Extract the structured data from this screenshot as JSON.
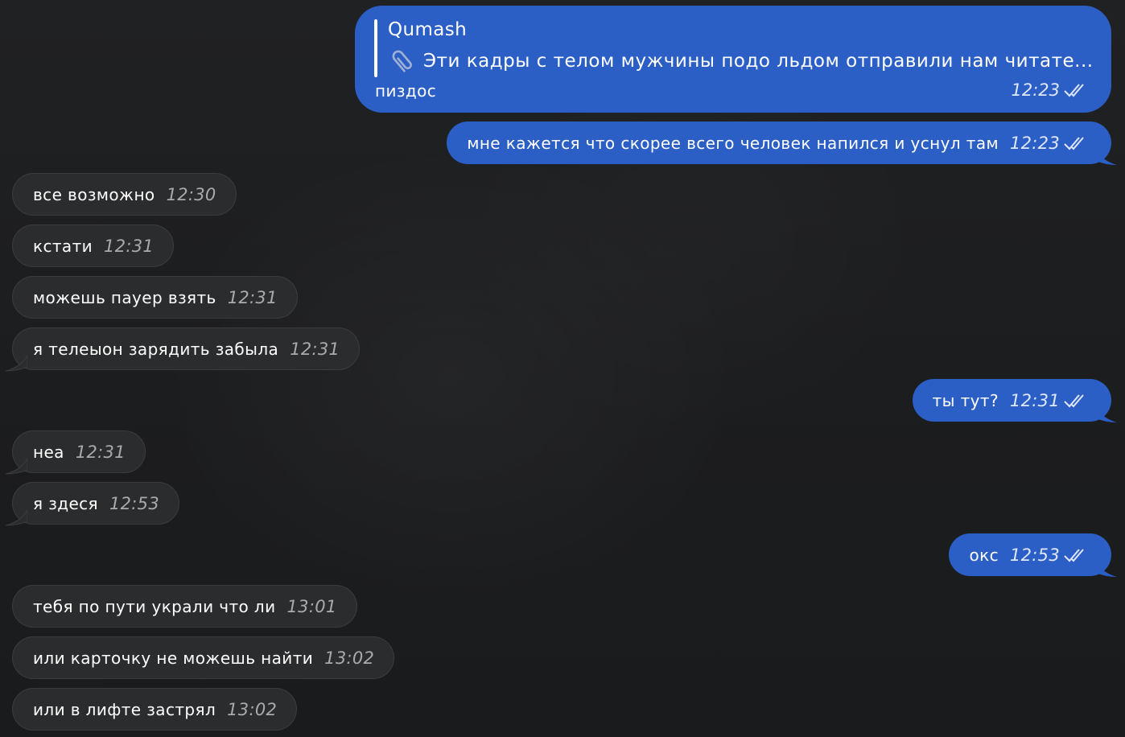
{
  "reply_message": {
    "quoted_author": "Qumash",
    "quoted_icon": "paperclip-icon",
    "quoted_text": "Эти кадры с телом мужчины подо льдом отправили нам читате...",
    "text": "пиздос",
    "time": "12:23",
    "status_icon": "double-check-icon"
  },
  "messages": [
    {
      "direction": "out",
      "text": "мне кажется что скорее всего человек напился и уснул там",
      "time": "12:23",
      "status_icon": "double-check-icon"
    },
    {
      "direction": "in",
      "text": "все возможно",
      "time": "12:30"
    },
    {
      "direction": "in",
      "text": "кстати",
      "time": "12:31"
    },
    {
      "direction": "in",
      "text": "можешь пауер взять",
      "time": "12:31"
    },
    {
      "direction": "in",
      "text": "я телеыон зарядить забыла",
      "time": "12:31"
    },
    {
      "direction": "out",
      "text": "ты тут?",
      "time": "12:31",
      "status_icon": "double-check-icon"
    },
    {
      "direction": "in",
      "text": "неа",
      "time": "12:31"
    },
    {
      "direction": "in",
      "text": "я здеся",
      "time": "12:53"
    },
    {
      "direction": "out",
      "text": "окс",
      "time": "12:53",
      "status_icon": "double-check-icon"
    },
    {
      "direction": "in",
      "text": "тебя по пути украли что ли",
      "time": "13:01"
    },
    {
      "direction": "in",
      "text": "или карточку не можешь найти",
      "time": "13:02"
    },
    {
      "direction": "in",
      "text": "или в лифте застрял",
      "time": "13:02"
    }
  ],
  "colors": {
    "outgoing_bubble": "#2b5fc5",
    "incoming_bubble": "#2b2c2e",
    "background": "#1b1c1e"
  }
}
